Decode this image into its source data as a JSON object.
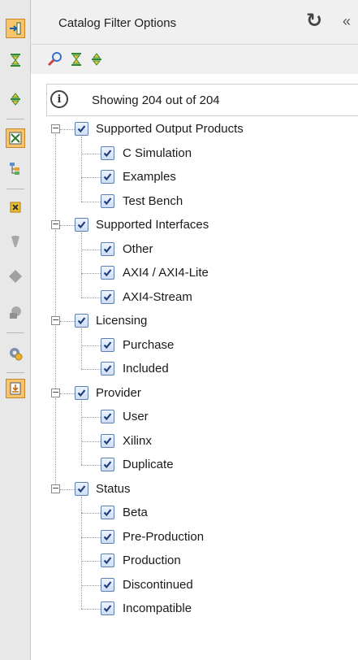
{
  "header": {
    "title": "Catalog Filter Options"
  },
  "status": {
    "text": "Showing 204 out of 204"
  },
  "colors": {
    "accent_active": "#f7c46c",
    "checkbox_border": "#5a7fb0",
    "check_mark": "#1f3f7a"
  },
  "icons": {
    "side_toolbar": [
      "import-icon",
      "collapse-all-icon",
      "expand-all-icon",
      "filter-icon",
      "tree-view-icon",
      "customize-ip-icon",
      "wrench-icon",
      "diamond-icon",
      "block-icon",
      "settings-gear-icon",
      "download-icon"
    ],
    "filter_toolbar": [
      "search-icon",
      "collapse-all-icon",
      "expand-all-icon"
    ]
  },
  "tree": [
    {
      "label": "Supported Output Products",
      "checked": true,
      "children": [
        {
          "label": "C Simulation",
          "checked": true
        },
        {
          "label": "Examples",
          "checked": true
        },
        {
          "label": "Test Bench",
          "checked": true
        }
      ]
    },
    {
      "label": "Supported Interfaces",
      "checked": true,
      "children": [
        {
          "label": "Other",
          "checked": true
        },
        {
          "label": "AXI4 / AXI4-Lite",
          "checked": true
        },
        {
          "label": "AXI4-Stream",
          "checked": true
        }
      ]
    },
    {
      "label": "Licensing",
      "checked": true,
      "children": [
        {
          "label": "Purchase",
          "checked": true
        },
        {
          "label": "Included",
          "checked": true
        }
      ]
    },
    {
      "label": "Provider",
      "checked": true,
      "children": [
        {
          "label": "User",
          "checked": true
        },
        {
          "label": "Xilinx",
          "checked": true
        },
        {
          "label": "Duplicate",
          "checked": true
        }
      ]
    },
    {
      "label": "Status",
      "checked": true,
      "children": [
        {
          "label": "Beta",
          "checked": true
        },
        {
          "label": "Pre-Production",
          "checked": true
        },
        {
          "label": "Production",
          "checked": true
        },
        {
          "label": "Discontinued",
          "checked": true
        },
        {
          "label": "Incompatible",
          "checked": true
        }
      ]
    }
  ]
}
